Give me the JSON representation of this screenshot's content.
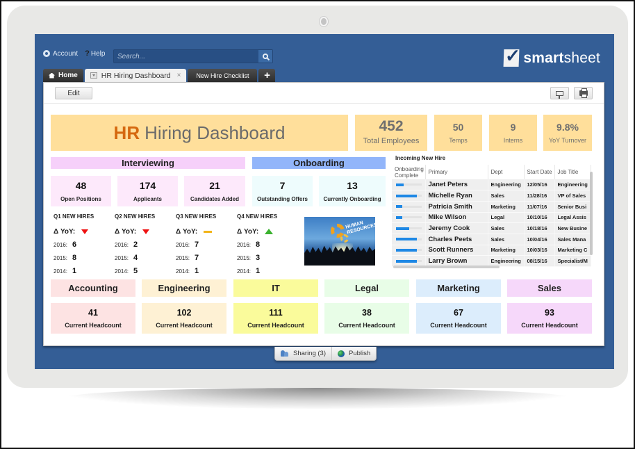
{
  "topbar": {
    "account_label": "Account",
    "help_label": "Help",
    "help_glyph": "?",
    "search_placeholder": "Search..."
  },
  "brand": {
    "logo_bold": "smart",
    "logo_rest": "sheet"
  },
  "tabs": [
    {
      "label": "Home",
      "icon": "home-icon"
    },
    {
      "label": "HR Hiring Dashboard",
      "icon": "dropdown-icon",
      "close": "×"
    },
    {
      "label": "New Hire Checklist"
    },
    {
      "label": "+"
    }
  ],
  "toolbar": {
    "edit_label": "Edit",
    "present_icon": "presentation-icon",
    "print_icon": "print-icon"
  },
  "header": {
    "title_accent": "HR",
    "title_rest": "Hiring Dashboard",
    "accent_color": "#d5680f",
    "stats": [
      {
        "value": "452",
        "label": "Total Employees"
      },
      {
        "value": "50",
        "label": "Temps"
      },
      {
        "value": "9",
        "label": "Interns"
      },
      {
        "value": "9.8%",
        "label": "YoY Turnover"
      }
    ]
  },
  "interviewing": {
    "title": "Interviewing",
    "kpis": [
      {
        "value": "48",
        "label": "Open Positions"
      },
      {
        "value": "174",
        "label": "Applicants"
      },
      {
        "value": "21",
        "label": "Candidates Added"
      }
    ]
  },
  "onboarding": {
    "title": "Onboarding",
    "kpis": [
      {
        "value": "7",
        "label": "Outstanding Offers"
      },
      {
        "value": "13",
        "label": "Currently Onboarding"
      }
    ]
  },
  "quarters": [
    {
      "title": "Q1 NEW HIRES",
      "yoy_label": "Δ YoY:",
      "trend": "down",
      "years": [
        {
          "year": "2016:",
          "n": "6"
        },
        {
          "year": "2015:",
          "n": "8"
        },
        {
          "year": "2014:",
          "n": "1"
        }
      ]
    },
    {
      "title": "Q2 NEW HIRES",
      "yoy_label": "Δ YoY:",
      "trend": "down",
      "years": [
        {
          "year": "2016:",
          "n": "2"
        },
        {
          "year": "2015:",
          "n": "4"
        },
        {
          "year": "2014:",
          "n": "5"
        }
      ]
    },
    {
      "title": "Q3 NEW HIRES",
      "yoy_label": "Δ YoY:",
      "trend": "flat",
      "years": [
        {
          "year": "2016:",
          "n": "7"
        },
        {
          "year": "2015:",
          "n": "7"
        },
        {
          "year": "2014:",
          "n": "1"
        }
      ]
    },
    {
      "title": "Q4 NEW HIRES",
      "yoy_label": "Δ YoY:",
      "trend": "up",
      "years": [
        {
          "year": "2016:",
          "n": "8"
        },
        {
          "year": "2015:",
          "n": "3"
        },
        {
          "year": "2014:",
          "n": "1"
        }
      ]
    }
  ],
  "image": {
    "caption": "HUMAN RESOURCES"
  },
  "new_hires": {
    "title": "Incoming New Hire",
    "columns": [
      "Onboarding Complete",
      "Primary",
      "Dept",
      "Start Date",
      "Job Title"
    ],
    "rows": [
      {
        "progress": 0.3,
        "name": "Janet Peters",
        "dept": "Engineering",
        "start": "12/05/16",
        "job": "Engineering"
      },
      {
        "progress": 0.8,
        "name": "Michelle Ryan",
        "dept": "Sales",
        "start": "11/28/16",
        "job": "VP of Sales"
      },
      {
        "progress": 0.25,
        "name": "Patricia Smith",
        "dept": "Marketing",
        "start": "11/07/16",
        "job": "Senior Busi"
      },
      {
        "progress": 0.25,
        "name": "Mike Wilson",
        "dept": "Legal",
        "start": "10/10/16",
        "job": "Legal Assis"
      },
      {
        "progress": 0.5,
        "name": "Jeremy Cook",
        "dept": "Sales",
        "start": "10/18/16",
        "job": "New Busine"
      },
      {
        "progress": 0.8,
        "name": "Charles Peets",
        "dept": "Sales",
        "start": "10/04/16",
        "job": "Sales Mana"
      },
      {
        "progress": 0.8,
        "name": "Scott Runners",
        "dept": "Marketing",
        "start": "10/03/16",
        "job": "Marketing C"
      },
      {
        "progress": 0.8,
        "name": "Larry Brown",
        "dept": "Engineering",
        "start": "08/15/16",
        "job": "Specialist/M"
      }
    ],
    "bar_color": "#1e88e5"
  },
  "departments": [
    {
      "name": "Accounting",
      "headcount": "41",
      "label": "Current Headcount",
      "color": "#fde3e3"
    },
    {
      "name": "Engineering",
      "headcount": "102",
      "label": "Current Headcount",
      "color": "#fef1d4"
    },
    {
      "name": "IT",
      "headcount": "111",
      "label": "Current Headcount",
      "color": "#fafb9b"
    },
    {
      "name": "Legal",
      "headcount": "38",
      "label": "Current Headcount",
      "color": "#e8fde7"
    },
    {
      "name": "Marketing",
      "headcount": "67",
      "label": "Current Headcount",
      "color": "#dcedfc"
    },
    {
      "name": "Sales",
      "headcount": "93",
      "label": "Current Headcount",
      "color": "#f6d8fa"
    }
  ],
  "footer": {
    "sharing_label": "Sharing (3)",
    "publish_label": "Publish"
  }
}
